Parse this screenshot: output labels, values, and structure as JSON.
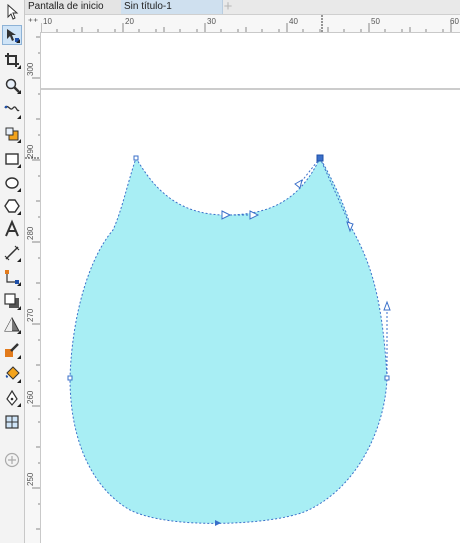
{
  "tabs": [
    {
      "label": "Pantalla de inicio",
      "active": false
    },
    {
      "label": "Sin título-1",
      "active": true
    }
  ],
  "tab_add_label": "+",
  "ruler_corner_label": "⁺⁺",
  "horizontal_ruler": {
    "labels": [
      "10",
      "20",
      "30",
      "40",
      "50",
      "60"
    ]
  },
  "vertical_ruler": {
    "labels": [
      "300",
      "290",
      "280",
      "270",
      "260",
      "250"
    ]
  },
  "toolbox": [
    {
      "name": "pick-tool",
      "icon": "arrow-cursor-icon",
      "active": false
    },
    {
      "name": "shape-tool",
      "icon": "shape-node-icon",
      "active": true
    },
    {
      "name": "crop-tool",
      "icon": "crop-icon",
      "active": false
    },
    {
      "name": "zoom-tool",
      "icon": "magnifier-icon",
      "active": false
    },
    {
      "name": "freehand-tool",
      "icon": "freehand-curve-icon",
      "active": false
    },
    {
      "name": "smart-fill-tool",
      "icon": "smart-fill-icon",
      "active": false
    },
    {
      "name": "rectangle-tool",
      "icon": "rectangle-icon",
      "active": false
    },
    {
      "name": "ellipse-tool",
      "icon": "ellipse-icon",
      "active": false
    },
    {
      "name": "polygon-tool",
      "icon": "polygon-icon",
      "active": false
    },
    {
      "name": "text-tool",
      "icon": "text-a-icon",
      "active": false
    },
    {
      "name": "parallel-dimension-tool",
      "icon": "dimension-line-icon",
      "active": false
    },
    {
      "name": "connector-tool",
      "icon": "connector-icon",
      "active": false
    },
    {
      "name": "drop-shadow-tool",
      "icon": "drop-shadow-icon",
      "active": false
    },
    {
      "name": "transparency-tool",
      "icon": "transparency-icon",
      "active": false
    },
    {
      "name": "color-eyedropper-tool",
      "icon": "eyedropper-icon",
      "active": false
    },
    {
      "name": "interactive-fill-tool",
      "icon": "paint-bucket-icon",
      "active": false
    },
    {
      "name": "smart-fill-pen-tool",
      "icon": "pen-nib-icon",
      "active": false
    },
    {
      "name": "mesh-fill-tool",
      "icon": "mesh-fill-icon",
      "active": false
    },
    {
      "name": "add-tool-button",
      "icon": "add-circle-icon",
      "active": false
    }
  ],
  "colors": {
    "shape_fill": "#a8eef4",
    "selection_outline": "#3a6fc9",
    "toolbox_active": "#cfe4f7"
  }
}
